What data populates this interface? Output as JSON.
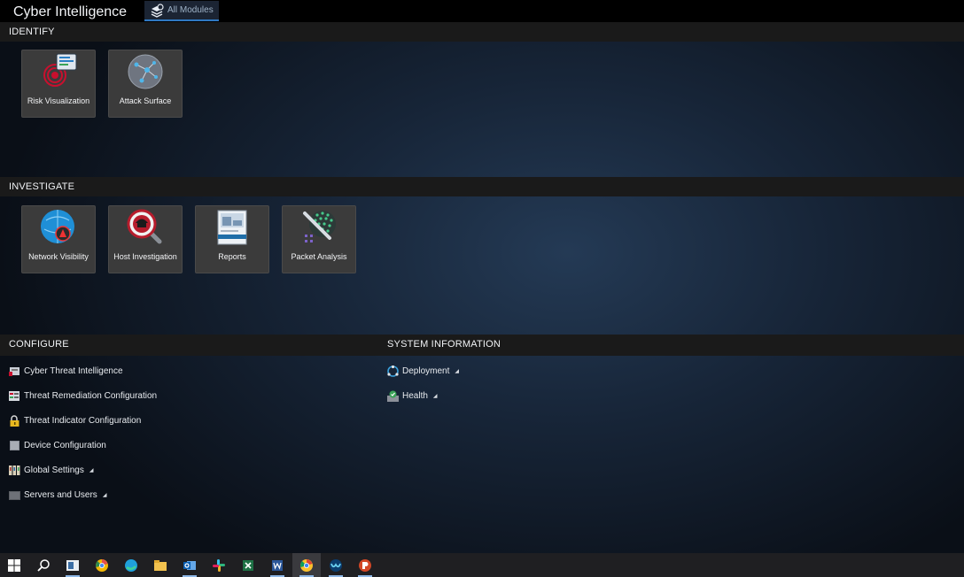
{
  "app": {
    "title": "Cyber Intelligence"
  },
  "tabs": {
    "all_modules": "All Modules"
  },
  "sections": {
    "identify": {
      "title": "IDENTIFY",
      "tiles": [
        {
          "label": "Risk Visualization",
          "icon": "radar-icon"
        },
        {
          "label": "Attack Surface",
          "icon": "network-globe-icon"
        }
      ]
    },
    "investigate": {
      "title": "INVESTIGATE",
      "tiles": [
        {
          "label": "Network Visibility",
          "icon": "network-visibility-icon"
        },
        {
          "label": "Host Investigation",
          "icon": "host-investigation-icon"
        },
        {
          "label": "Reports",
          "icon": "reports-icon"
        },
        {
          "label": "Packet Analysis",
          "icon": "packet-analysis-icon"
        }
      ]
    },
    "configure": {
      "title": "CONFIGURE",
      "items": [
        {
          "label": "Cyber Threat Intelligence",
          "icon": "threat-intel-icon"
        },
        {
          "label": "Threat Remediation Configuration",
          "icon": "remediation-icon"
        },
        {
          "label": "Threat Indicator Configuration",
          "icon": "lock-icon"
        },
        {
          "label": "Device Configuration",
          "icon": "device-icon"
        },
        {
          "label": "Global Settings",
          "icon": "settings-files-icon"
        },
        {
          "label": "Servers and Users",
          "icon": "server-icon"
        }
      ]
    },
    "system_information": {
      "title": "SYSTEM INFORMATION",
      "items": [
        {
          "label": "Deployment",
          "icon": "deployment-icon"
        },
        {
          "label": "Health",
          "icon": "health-icon"
        }
      ]
    }
  },
  "taskbar": {
    "items": [
      "windows-start-icon",
      "search-icon",
      "task-view-icon",
      "chrome-canary-icon",
      "edge-icon",
      "file-explorer-icon",
      "outlook-icon",
      "slack-icon",
      "excel-icon",
      "word-icon",
      "chrome-icon",
      "webex-icon",
      "powerpoint-icon"
    ]
  },
  "colors": {
    "accent": "#2f79c2",
    "header_bg": "#1a1a1a",
    "tile_bg": "#3b3b3b"
  }
}
